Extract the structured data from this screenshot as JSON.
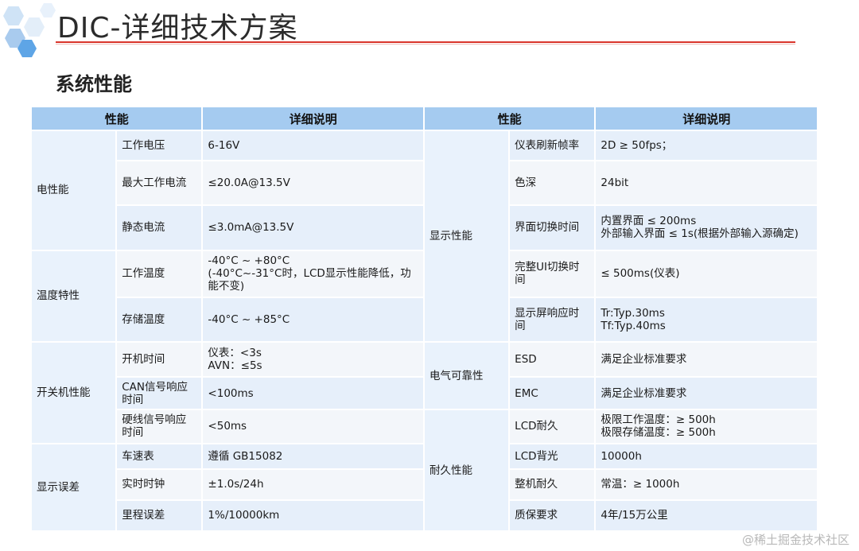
{
  "title": "DIC-详细技术方案",
  "section_title": "系统性能",
  "headers": [
    "性能",
    "详细说明",
    "性能",
    "详细说明"
  ],
  "left": {
    "groups": [
      {
        "category": "电性能",
        "rows": [
          {
            "name": "工作电压",
            "desc": "6-16V"
          },
          {
            "name": "最大工作电流",
            "desc": "≤20.0A@13.5V"
          },
          {
            "name": "静态电流",
            "desc": "≤3.0mA@13.5V"
          }
        ]
      },
      {
        "category": "温度特性",
        "rows": [
          {
            "name": "工作温度",
            "desc": "-40°C ~ +80°C\n(-40°C~-31°C时，LCD显示性能降低，功能不变)"
          },
          {
            "name": "存储温度",
            "desc": "-40°C ~ +85°C"
          }
        ]
      },
      {
        "category": "开关机性能",
        "rows": [
          {
            "name": "开机时间",
            "desc": "仪表：<3s\nAVN：≤5s"
          },
          {
            "name": "CAN信号响应\n时间",
            "desc": "<100ms"
          },
          {
            "name": "硬线信号响应\n时间",
            "desc": "<50ms"
          }
        ]
      },
      {
        "category": "显示误差",
        "rows": [
          {
            "name": "车速表",
            "desc": "遵循 GB15082"
          },
          {
            "name": "实时时钟",
            "desc": "±1.0s/24h"
          },
          {
            "name": "里程误差",
            "desc": "1%/10000km"
          }
        ]
      }
    ]
  },
  "right": {
    "groups": [
      {
        "category": "显示性能",
        "rows": [
          {
            "name": "仪表刷新帧率",
            "desc": "2D ≥ 50fps；"
          },
          {
            "name": "色深",
            "desc": "24bit"
          },
          {
            "name": "界面切换时间",
            "desc": "内置界面 ≤ 200ms\n外部输入界面 ≤ 1s(根据外部输入源确定)"
          },
          {
            "name": "完整UI切换时\n间",
            "desc": "≤ 500ms(仪表)"
          },
          {
            "name": "显示屏响应时\n间",
            "desc": "Tr:Typ.30ms\nTf:Typ.40ms"
          }
        ]
      },
      {
        "category": "电气可靠性",
        "rows": [
          {
            "name": "ESD",
            "desc": "满足企业标准要求"
          },
          {
            "name": "EMC",
            "desc": "满足企业标准要求"
          }
        ]
      },
      {
        "category": "耐久性能",
        "rows": [
          {
            "name": "LCD耐久",
            "desc": "极限工作温度：≥ 500h\n极限存储温度：≥ 500h"
          },
          {
            "name": "LCD背光",
            "desc": "10000h"
          },
          {
            "name": "整机耐久",
            "desc": "常温：≥ 1000h"
          },
          {
            "name": "质保要求",
            "desc": "4年/15万公里"
          }
        ]
      }
    ]
  },
  "watermark": "@稀土掘金技术社区"
}
